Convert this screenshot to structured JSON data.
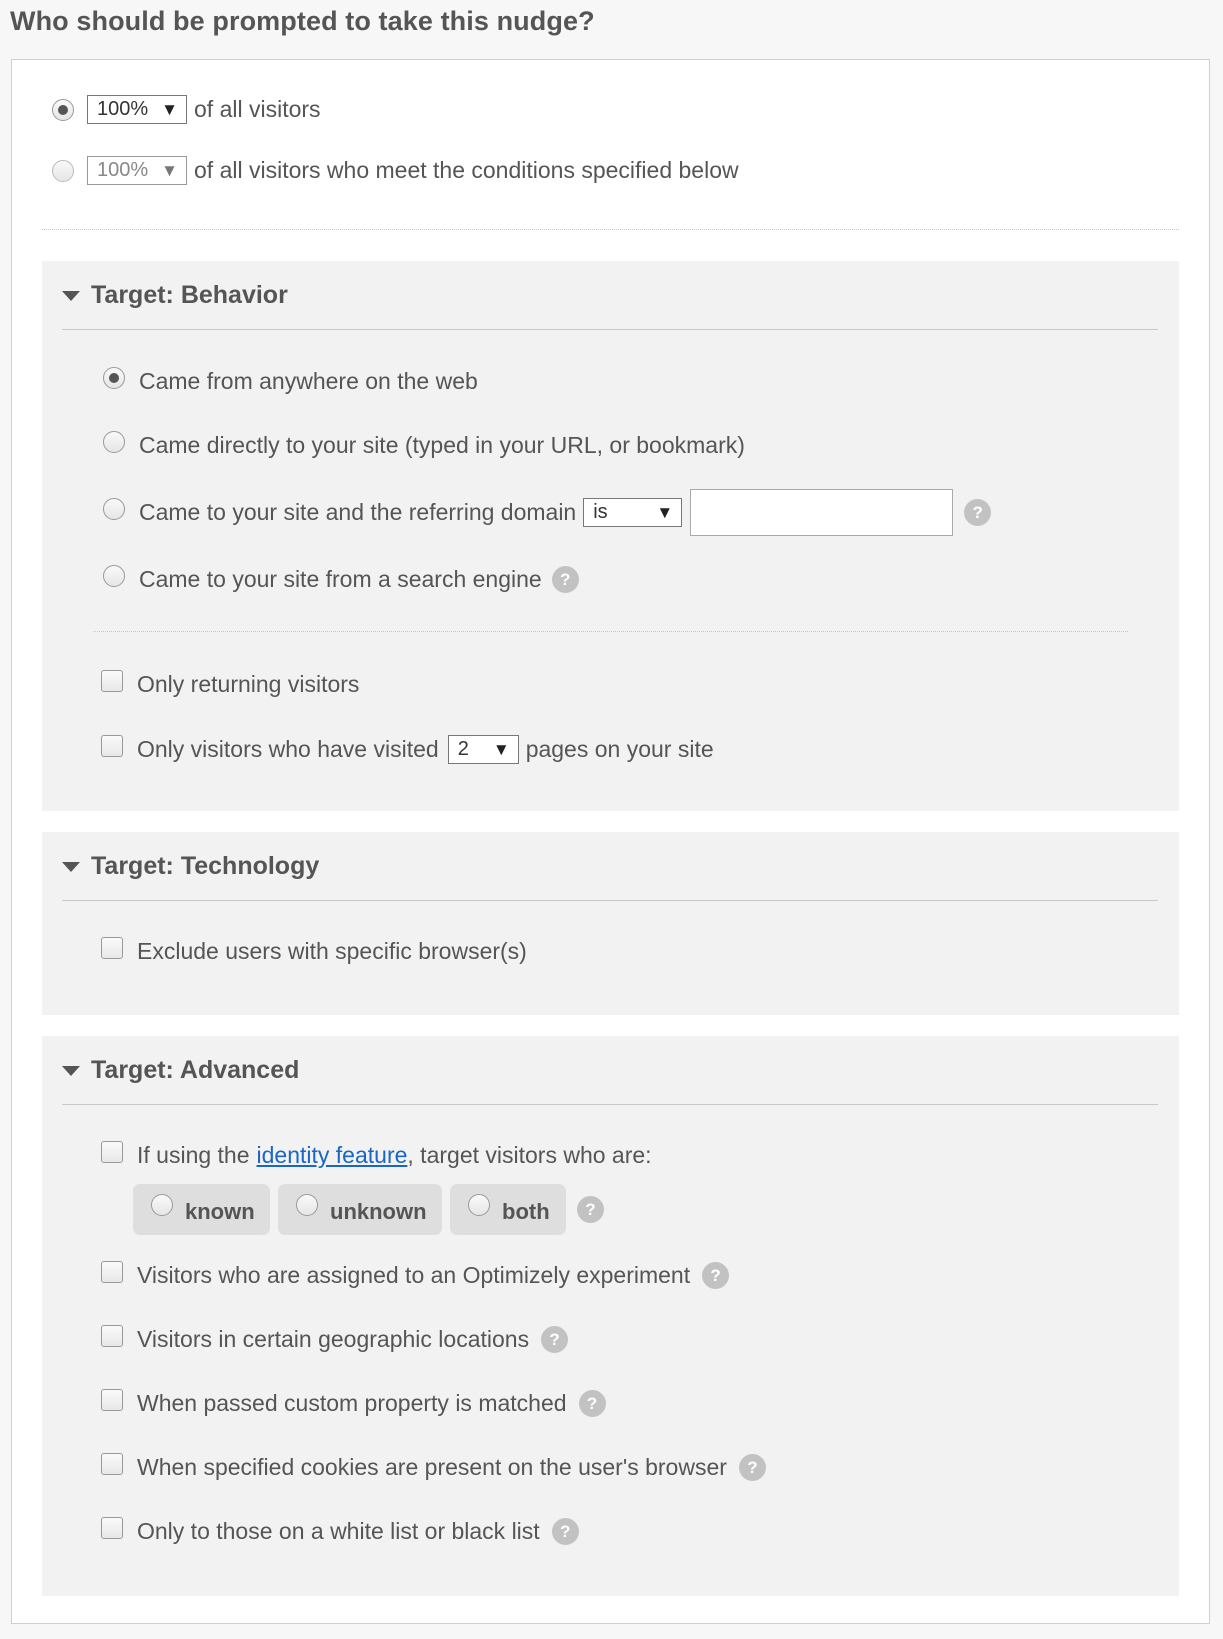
{
  "title": "Who should be prompted to take this nudge?",
  "audience": {
    "option_all": {
      "percent": "100%",
      "label": "of all visitors",
      "selected": true
    },
    "option_conditions": {
      "percent": "100%",
      "label": "of all visitors who meet the conditions specified below",
      "selected": false
    }
  },
  "behavior": {
    "header": "Target: Behavior",
    "options": [
      {
        "label": "Came from anywhere on the web",
        "selected": true
      },
      {
        "label": "Came directly to your site (typed in your URL, or bookmark)",
        "selected": false
      },
      {
        "label": "Came to your site and the referring domain",
        "selected": false,
        "operator": "is",
        "domain_value": ""
      },
      {
        "label": "Came to your site from a search engine",
        "selected": false
      }
    ],
    "returning_label": "Only returning visitors",
    "visited_prefix": "Only visitors who have visited",
    "visited_count": "2",
    "visited_suffix": "pages on your site"
  },
  "technology": {
    "header": "Target: Technology",
    "exclude_browsers_label": "Exclude users with specific browser(s)"
  },
  "advanced": {
    "header": "Target: Advanced",
    "identity_prefix": "If using the",
    "identity_link": "identity feature",
    "identity_suffix": ", target visitors who are:",
    "identity_options": [
      "known",
      "unknown",
      "both"
    ],
    "items": [
      "Visitors who are assigned to an Optimizely experiment",
      "Visitors in certain geographic locations",
      "When passed custom property is matched",
      "When specified cookies are present on the user's browser",
      "Only to those on a white list or black list"
    ]
  },
  "icons": {
    "help": "help-icon",
    "caret": "caret-down-icon",
    "collapse": "triangle-down-icon"
  },
  "help_glyph": "?",
  "caret_glyph": "▼"
}
